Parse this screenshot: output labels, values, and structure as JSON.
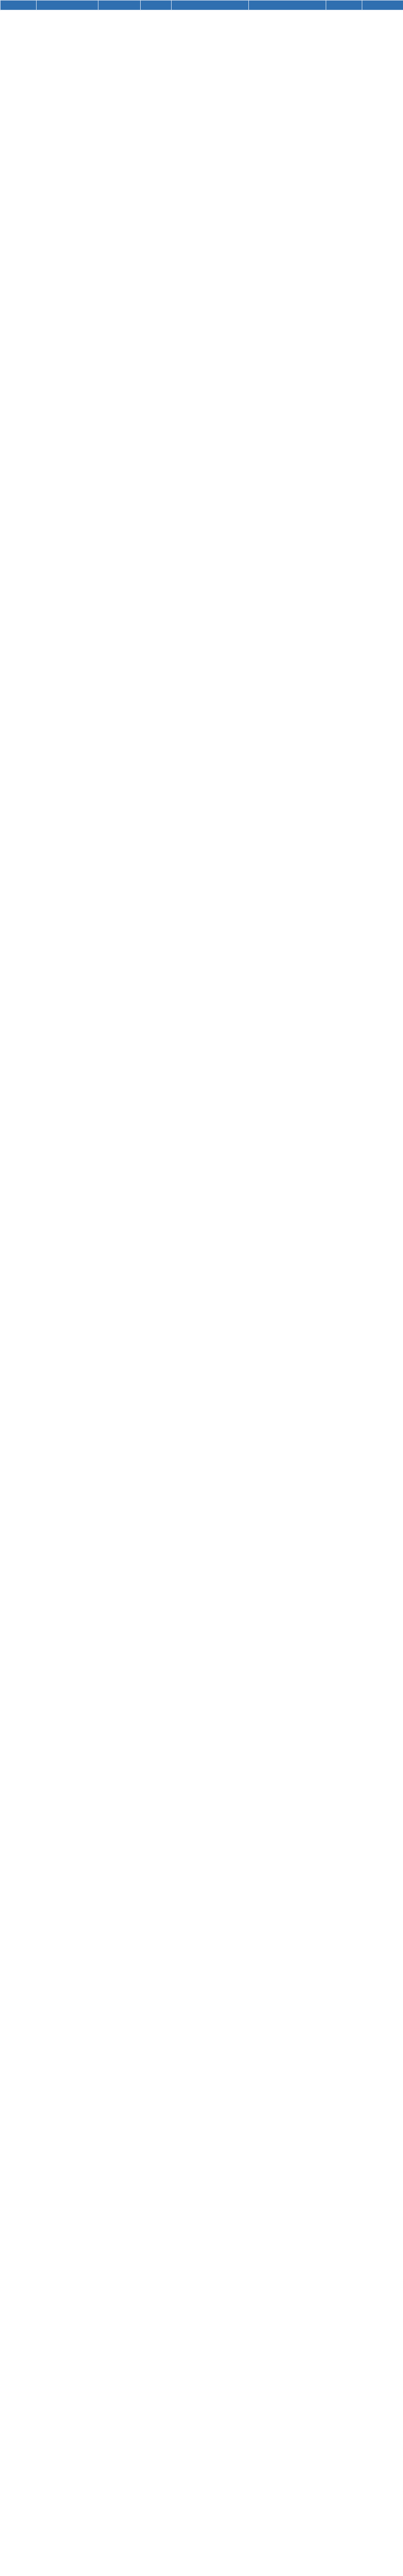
{
  "table": {
    "columns": [
      {
        "label": ""
      },
      {
        "label": ""
      },
      {
        "label": ""
      },
      {
        "label": ""
      },
      {
        "label": ""
      },
      {
        "label": ""
      },
      {
        "label": ""
      },
      {
        "label": ""
      }
    ],
    "rows": []
  }
}
